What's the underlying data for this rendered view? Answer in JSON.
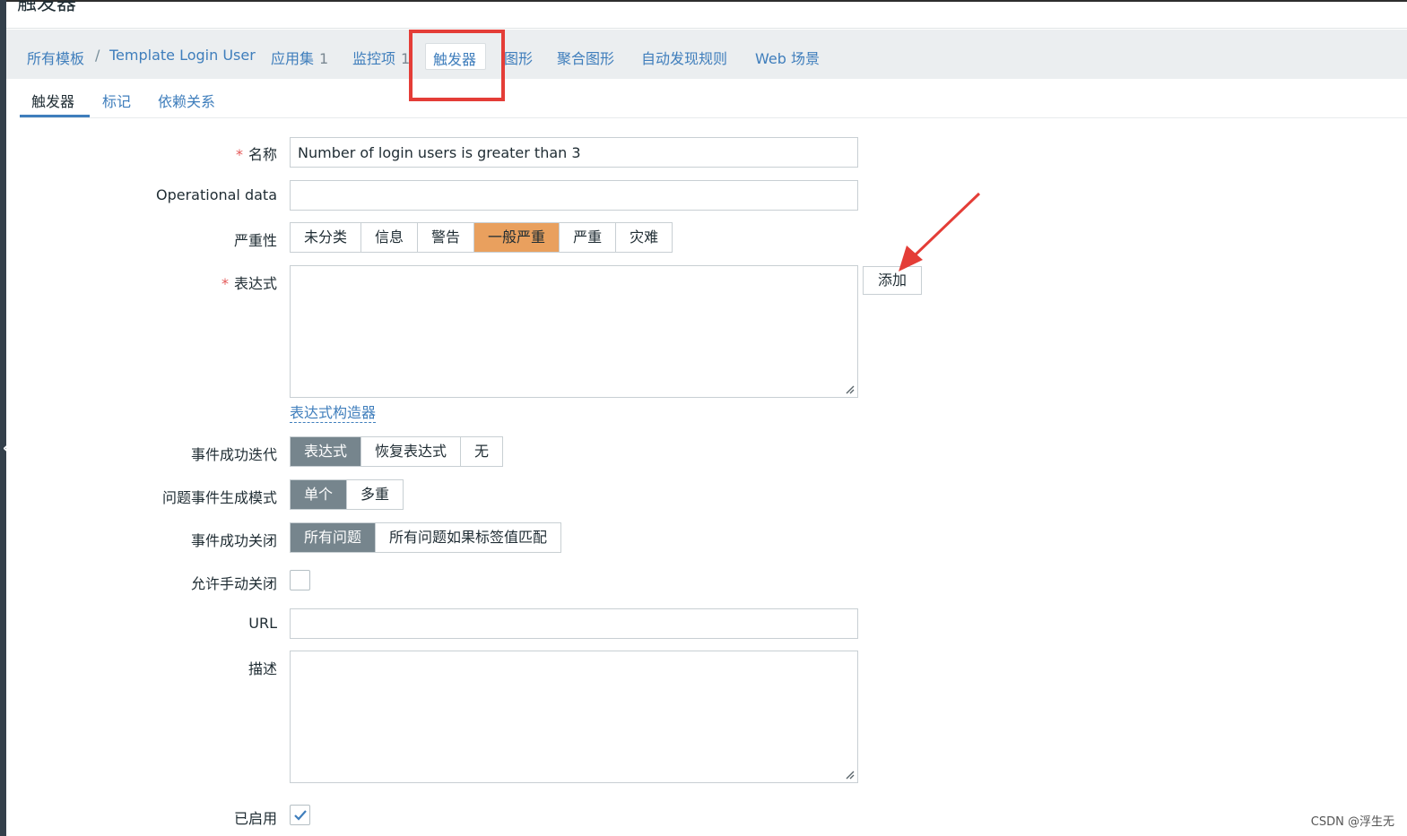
{
  "page": {
    "title": "触发器"
  },
  "nav": {
    "all_templates": "所有模板",
    "separator": "/",
    "template_name": "Template Login User",
    "items": [
      {
        "label": "应用集",
        "count": "1"
      },
      {
        "label": "监控项",
        "count": "1"
      },
      {
        "label": "触发器"
      },
      {
        "label": "图形"
      },
      {
        "label": "聚合图形"
      },
      {
        "label": "自动发现规则"
      },
      {
        "label": "Web 场景"
      }
    ]
  },
  "tabs": [
    {
      "label": "触发器"
    },
    {
      "label": "标记"
    },
    {
      "label": "依赖关系"
    }
  ],
  "form": {
    "required_mark": "*",
    "name_label": "名称",
    "name_value": "Number of login users is greater than 3",
    "opdata_label": "Operational data",
    "opdata_value": "",
    "severity_label": "严重性",
    "severity_options": [
      "未分类",
      "信息",
      "警告",
      "一般严重",
      "严重",
      "灾难"
    ],
    "severity_selected": "一般严重",
    "expression_label": "表达式",
    "add_button": "添加",
    "expression_builder": "表达式构造器",
    "ok_event_label": "事件成功迭代",
    "ok_event_options": [
      "表达式",
      "恢复表达式",
      "无"
    ],
    "ok_event_selected": "表达式",
    "problem_mode_label": "问题事件生成模式",
    "problem_mode_options": [
      "单个",
      "多重"
    ],
    "problem_mode_selected": "单个",
    "ok_close_label": "事件成功关闭",
    "ok_close_options": [
      "所有问题",
      "所有问题如果标签值匹配"
    ],
    "ok_close_selected": "所有问题",
    "manual_close_label": "允许手动关闭",
    "manual_close_checked": false,
    "url_label": "URL",
    "url_value": "",
    "description_label": "描述",
    "enabled_label": "已启用",
    "enabled_checked": true
  },
  "watermark": "CSDN @浮生无",
  "colors": {
    "link": "#3f7ebc",
    "selected_gray": "#76858d",
    "selected_orange": "#e9a05e",
    "annotation_red": "#e43d37"
  }
}
